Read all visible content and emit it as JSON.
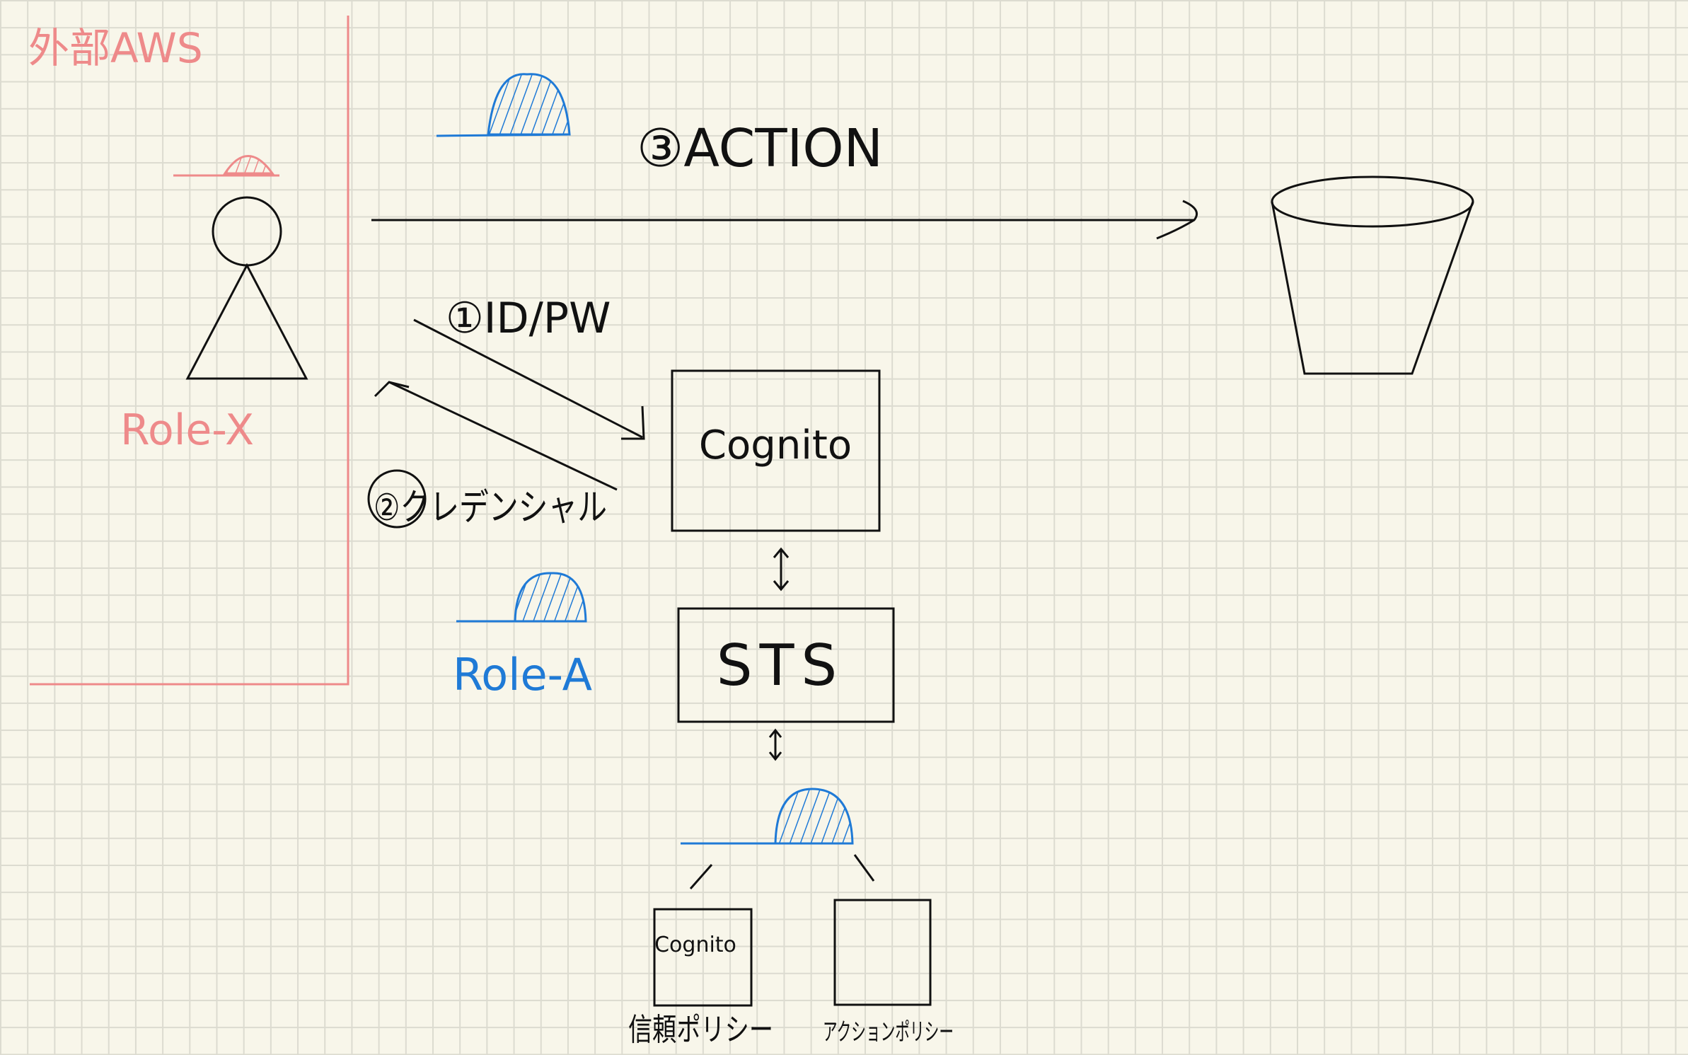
{
  "external_zone": {
    "label": "外部AWS",
    "color": "#ee8a8a"
  },
  "user": {
    "role_label": "Role-X"
  },
  "flows": {
    "action": "③ACTION",
    "login": "①ID/PW",
    "credential": "②クレデンシャル"
  },
  "services": {
    "cognito": "Cognito",
    "sts": "STS"
  },
  "role_a": {
    "label": "Role-A",
    "color": "#1f7ad6"
  },
  "policies": {
    "trust_box_text": "Cognito",
    "trust_label": "信頼ポリシー",
    "action_label": "アクションポリシー"
  }
}
